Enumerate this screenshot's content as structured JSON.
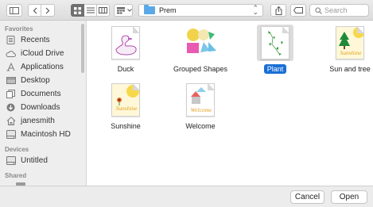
{
  "toolbar": {
    "current_folder": "Prem",
    "search_placeholder": "Search"
  },
  "sidebar": {
    "favorites_header": "Favorites",
    "favorites": [
      {
        "label": "Recents",
        "icon": "recents-icon"
      },
      {
        "label": "iCloud Drive",
        "icon": "cloud-icon"
      },
      {
        "label": "Applications",
        "icon": "applications-icon"
      },
      {
        "label": "Desktop",
        "icon": "desktop-icon"
      },
      {
        "label": "Documents",
        "icon": "documents-icon"
      },
      {
        "label": "Downloads",
        "icon": "downloads-icon"
      },
      {
        "label": "janesmith",
        "icon": "home-icon"
      },
      {
        "label": "Macintosh HD",
        "icon": "disk-icon"
      }
    ],
    "devices_header": "Devices",
    "devices": [
      {
        "label": "Untitled",
        "icon": "disk-icon"
      }
    ],
    "shared_header": "Shared"
  },
  "files": [
    {
      "name": "Duck",
      "selected": false
    },
    {
      "name": "Grouped Shapes",
      "selected": false
    },
    {
      "name": "Plant",
      "selected": true
    },
    {
      "name": "Sun and tree",
      "selected": false
    },
    {
      "name": "Sunshine",
      "selected": false
    },
    {
      "name": "Welcome",
      "selected": false
    }
  ],
  "thumb_text": {
    "sun_and_tree": "Sunshine",
    "sunshine": "Sunshine",
    "welcome": "Welcome"
  },
  "buttons": {
    "cancel": "Cancel",
    "open": "Open"
  },
  "colors": {
    "selection": "#1a6fd6",
    "folder": "#5aa9e6",
    "active_view": "#6f6f6f"
  }
}
